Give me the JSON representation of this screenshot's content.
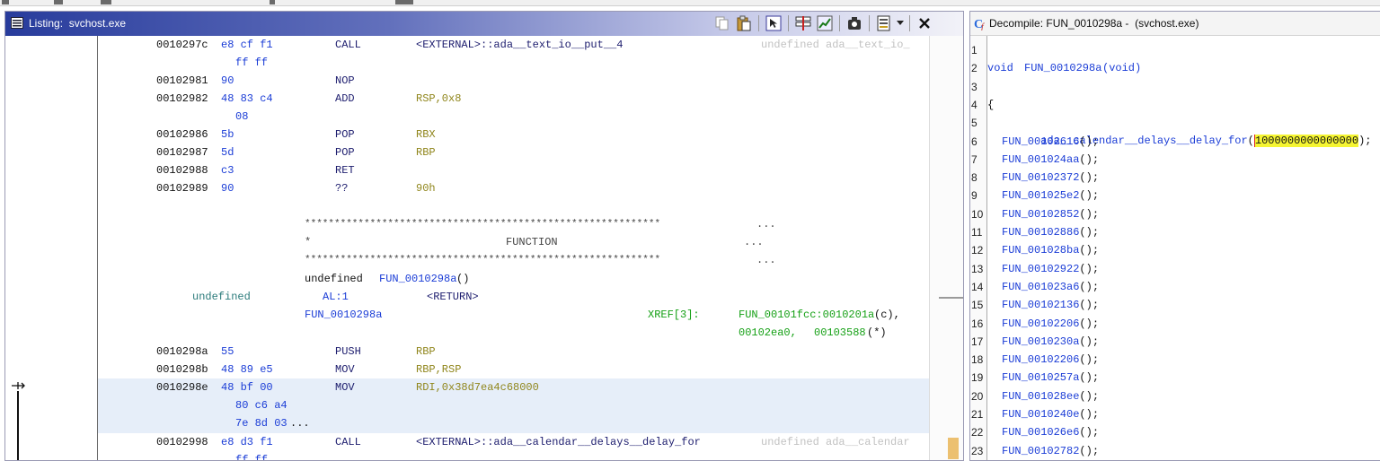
{
  "listing": {
    "title": "Listing:  svchost.exe",
    "rows": [
      {
        "addr": "0010297c",
        "bytes": "e8 cf f1",
        "mn": "CALL",
        "op": "<EXTERNAL>::ada__text_io__put__4",
        "cmt": "undefined ada__text_io_"
      },
      {
        "bytes": "ff ff"
      },
      {
        "addr": "00102981",
        "bytes": "90",
        "mn": "NOP"
      },
      {
        "addr": "00102982",
        "bytes": "48 83 c4",
        "mn": "ADD",
        "op": "RSP,0x8"
      },
      {
        "bytes": "08"
      },
      {
        "addr": "00102986",
        "bytes": "5b",
        "mn": "POP",
        "op": "RBX"
      },
      {
        "addr": "00102987",
        "bytes": "5d",
        "mn": "POP",
        "op": "RBP"
      },
      {
        "addr": "00102988",
        "bytes": "c3",
        "mn": "RET"
      },
      {
        "addr": "00102989",
        "bytes": "90",
        "mn": "??",
        "op": "90h"
      }
    ],
    "header": {
      "stars": "************************************************************",
      "ellipsis": "...",
      "star": "*",
      "function_label": "FUNCTION",
      "signature_prefix": "undefined ",
      "signature_name": "FUN_0010298a",
      "signature_suffix": "()",
      "ret_type": "undefined",
      "ret_storage": "AL:1",
      "ret_name": "<RETURN>",
      "label": "FUN_0010298a",
      "xref_label": "XREF[3]:",
      "xref_1a": "FUN_00101fcc:0010201a",
      "xref_1b": "(c),",
      "xref_2a": "00102ea0,",
      "xref_2b": "00103588",
      "xref_2c": "(*)"
    },
    "rows2": [
      {
        "addr": "0010298a",
        "bytes": "55",
        "mn": "PUSH",
        "op": "RBP"
      },
      {
        "addr": "0010298b",
        "bytes": "48 89 e5",
        "mn": "MOV",
        "op": "RBP,RSP"
      },
      {
        "addr": "0010298e",
        "bytes": "48 bf 00",
        "mn": "MOV",
        "op": "RDI,0x38d7ea4c68000"
      },
      {
        "bytes": "80 c6 a4"
      },
      {
        "bytes": "7e 8d 03",
        "more": "..."
      },
      {
        "addr": "00102998",
        "bytes": "e8 d3 f1",
        "mn": "CALL",
        "op": "<EXTERNAL>::ada__calendar__delays__delay_for",
        "cmt": "undefined ada__calendar"
      },
      {
        "bytes": "ff ff"
      }
    ]
  },
  "decompile": {
    "title": "Decompile: FUN_0010298a -  (svchost.exe)",
    "signature_kw": "void",
    "signature_name": "FUN_0010298a",
    "signature_args": "(void)",
    "brace": "{",
    "delay_call": "ada__calendar__delays__delay_for",
    "delay_open": "(",
    "delay_cursor_char": "1",
    "delay_arg_hl": "000000000000000",
    "delay_close": ");",
    "paren": "();",
    "calls": [
      "FUN_00102616",
      "FUN_001024aa",
      "FUN_00102372",
      "FUN_001025e2",
      "FUN_00102852",
      "FUN_00102886",
      "FUN_001028ba",
      "FUN_00102922",
      "FUN_001023a6",
      "FUN_00102136",
      "FUN_00102206",
      "FUN_0010230a",
      "FUN_00102206",
      "FUN_0010257a",
      "FUN_001028ee",
      "FUN_0010240e",
      "FUN_001026e6",
      "FUN_00102782"
    ],
    "line_numbers": [
      "1",
      "2",
      "3",
      "4",
      "5",
      "6",
      "7",
      "8",
      "9",
      "10",
      "11",
      "12",
      "13",
      "14",
      "15",
      "16",
      "17",
      "18",
      "19",
      "20",
      "21",
      "22",
      "23"
    ]
  },
  "colors": {
    "accent": "#283c9c",
    "bytes": "#1a3cd6",
    "operand": "#90861c",
    "highlight": "#f5f532",
    "row_highlight": "#e6eef9"
  },
  "icons": [
    "listing-icon",
    "copy-icon",
    "paste-icon",
    "cursor-select-icon",
    "field-edit-icon",
    "graph-icon",
    "snapshot-icon",
    "display-options-icon",
    "dropdown-icon",
    "close-icon",
    "decompile-icon"
  ]
}
